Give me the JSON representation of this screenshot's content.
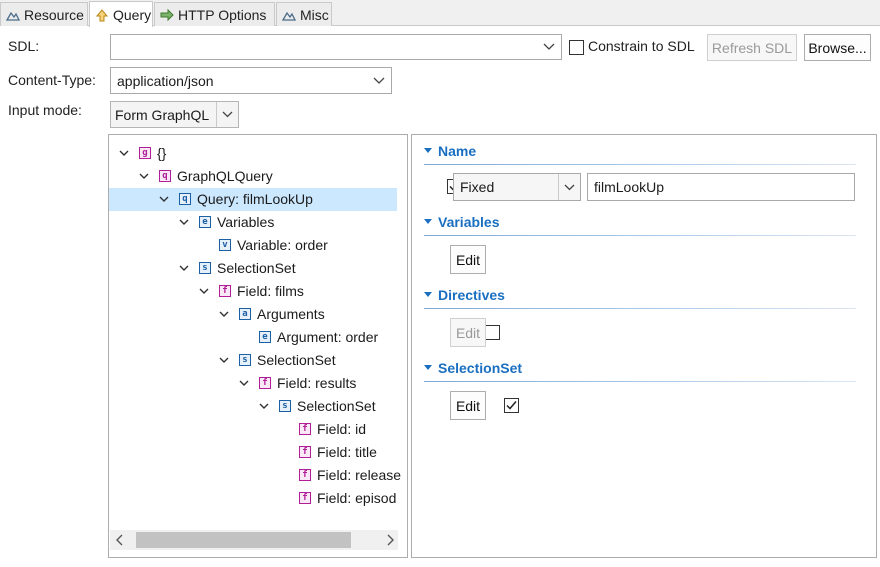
{
  "tabs": [
    {
      "label": "Resource",
      "icon": "resource-icon"
    },
    {
      "label": "Query",
      "icon": "query-icon"
    },
    {
      "label": "HTTP Options",
      "icon": "http-options-icon"
    },
    {
      "label": "Misc",
      "icon": "misc-icon"
    }
  ],
  "form": {
    "sdl_label": "SDL:",
    "sdl_value": "",
    "constrain_label": "Constrain to SDL",
    "constrain_checked": false,
    "refresh_label": "Refresh SDL",
    "browse_label": "Browse...",
    "content_type_label": "Content-Type:",
    "content_type_value": "application/json",
    "input_mode_label": "Input mode:",
    "input_mode_value": "Form GraphQL"
  },
  "tree": {
    "nodes": [
      {
        "badge": "g",
        "label": "{}"
      },
      {
        "badge": "q",
        "label": "GraphQLQuery"
      },
      {
        "badge": "q",
        "label": "Query: filmLookUp"
      },
      {
        "badge": "e",
        "label": "Variables"
      },
      {
        "badge": "v",
        "label": "Variable: order"
      },
      {
        "badge": "s",
        "label": "SelectionSet"
      },
      {
        "badge": "f",
        "label": "Field: films"
      },
      {
        "badge": "a",
        "label": "Arguments"
      },
      {
        "badge": "e",
        "label": "Argument: order"
      },
      {
        "badge": "s",
        "label": "SelectionSet"
      },
      {
        "badge": "f",
        "label": "Field: results"
      },
      {
        "badge": "s",
        "label": "SelectionSet"
      },
      {
        "badge": "f",
        "label": "Field: id"
      },
      {
        "badge": "f",
        "label": "Field: title"
      },
      {
        "badge": "f",
        "label": "Field: release"
      },
      {
        "badge": "f",
        "label": "Field: episod"
      }
    ]
  },
  "details": {
    "name_heading": "Name",
    "name_checked": true,
    "name_mode": "Fixed",
    "name_value": "filmLookUp",
    "variables_heading": "Variables",
    "variables_checked": true,
    "variables_edit": "Edit",
    "directives_heading": "Directives",
    "directives_checked": false,
    "directives_edit": "Edit",
    "selectionset_heading": "SelectionSet",
    "selectionset_checked": true,
    "selectionset_edit": "Edit"
  },
  "colors": {
    "accent": "#1a6fc0",
    "selection": "#cce8ff",
    "badge_pink": "#b01e98",
    "badge_blue": "#1d5fa3"
  }
}
